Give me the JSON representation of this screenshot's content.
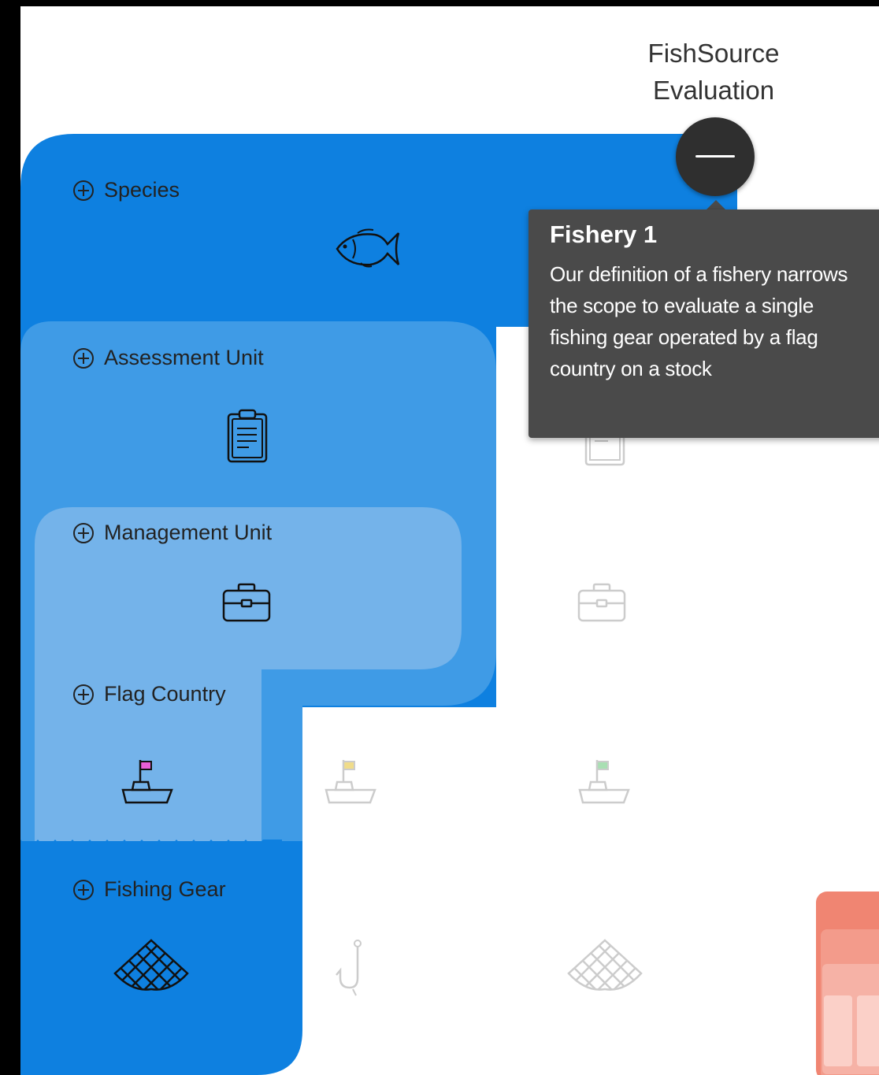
{
  "header": {
    "title_line1": "FishSource",
    "title_line2": "Evaluation"
  },
  "levels": {
    "species": "Species",
    "assessment_unit": "Assessment Unit",
    "management_unit": "Management Unit",
    "flag_country": "Flag Country",
    "fishing_gear": "Fishing Gear"
  },
  "tooltip": {
    "title": "Fishery 1",
    "body": "Our definition of a fishery narrows the scope to evaluate a single fishing gear operated by a flag country on a stock"
  },
  "icons": {
    "expand": "plus-circle-icon",
    "species": "fish-icon",
    "assessment_unit": "clipboard-icon",
    "management_unit": "briefcase-icon",
    "flag_country": "boat-flag-icon",
    "fishing_gear_net": "net-icon",
    "fishing_gear_hook": "hook-icon",
    "toggle": "minus-icon"
  },
  "colors": {
    "species_level": "#0e80e0",
    "assessment_level": "#3f9be6",
    "management_level": "#74b3ea",
    "tooltip_bg": "#4a4a4a",
    "toggle_bg": "#2f2f2f",
    "flag_selected": "#e85fd7",
    "flag_alt_yellow": "#f0dc8a",
    "flag_alt_green": "#a9dfb3",
    "side_card": "#f08572"
  }
}
